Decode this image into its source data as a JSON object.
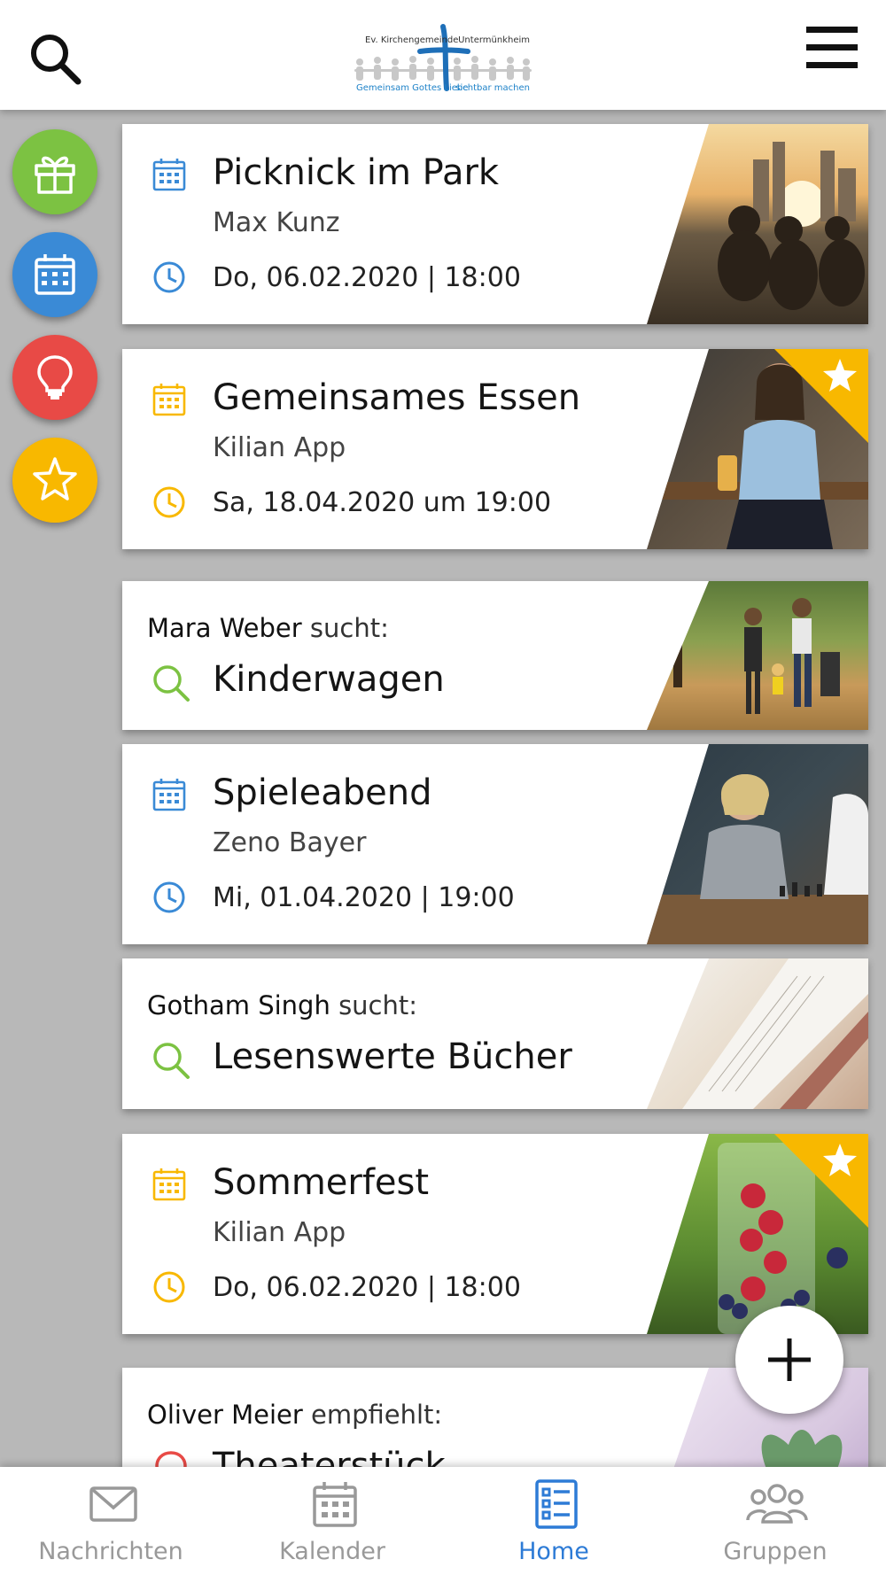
{
  "header": {
    "logo": {
      "top_left": "Ev. Kirchengemeinde",
      "top_right": "Untermünkheim",
      "bottom_left": "Gemeinsam Gottes Liebe",
      "bottom_right": "sichtbar machen"
    },
    "icons": {
      "search": "search-icon",
      "menu": "hamburger-menu-icon"
    }
  },
  "sidebar": {
    "items": [
      {
        "icon": "gift-icon",
        "color": "#7cc242"
      },
      {
        "icon": "calendar-icon",
        "color": "#3a8ad6"
      },
      {
        "icon": "lightbulb-icon",
        "color": "#e84a46"
      },
      {
        "icon": "star-icon",
        "color": "#f8b800"
      }
    ]
  },
  "feed": [
    {
      "type": "event",
      "title": "Picknick im Park",
      "organizer": "Max Kunz",
      "datetime": "Do, 06.02.2020 | 18:00",
      "accent": "#3a8ad6",
      "starred": false
    },
    {
      "type": "event",
      "title": "Gemeinsames Essen",
      "organizer": "Kilian App",
      "datetime": "Sa, 18.04.2020 um 19:00",
      "accent": "#f8b800",
      "starred": true
    },
    {
      "type": "search",
      "name": "Mara Weber",
      "verb": "sucht:",
      "title": "Kinderwagen",
      "accent": "#7cc242"
    },
    {
      "type": "event",
      "title": "Spieleabend",
      "organizer": "Zeno Bayer",
      "datetime": "Mi, 01.04.2020 | 19:00",
      "accent": "#3a8ad6",
      "starred": false
    },
    {
      "type": "search",
      "name": "Gotham Singh",
      "verb": "sucht:",
      "title": "Lesenswerte Bücher",
      "accent": "#7cc242"
    },
    {
      "type": "event",
      "title": "Sommerfest",
      "organizer": "Kilian App",
      "datetime": "Do, 06.02.2020 | 18:00",
      "accent": "#f8b800",
      "starred": true
    },
    {
      "type": "recommend",
      "name": "Oliver Meier",
      "verb": "empfiehlt:",
      "title": "Theaterstück",
      "accent": "#e84a46"
    }
  ],
  "fab": {
    "icon": "plus-icon"
  },
  "bottom_nav": [
    {
      "label": "Nachrichten",
      "icon": "mail-icon",
      "active": false
    },
    {
      "label": "Kalender",
      "icon": "calendar-icon",
      "active": false
    },
    {
      "label": "Home",
      "icon": "list-icon",
      "active": true
    },
    {
      "label": "Gruppen",
      "icon": "group-icon",
      "active": false
    }
  ],
  "colors": {
    "active": "#2d7bd6",
    "inactive": "#999999"
  }
}
